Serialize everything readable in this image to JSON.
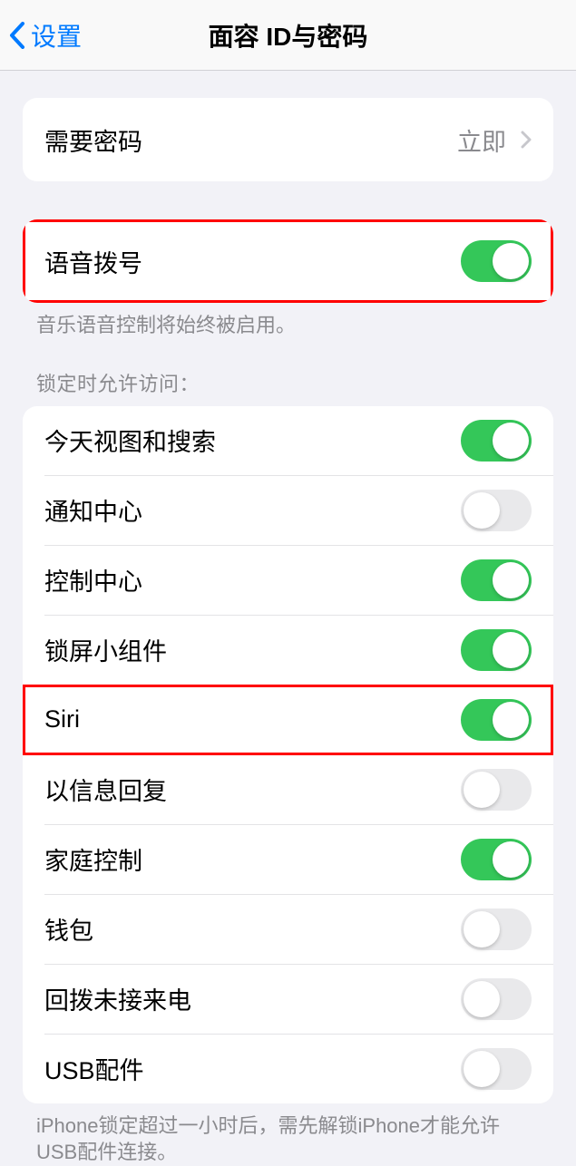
{
  "header": {
    "back_label": "设置",
    "title": "面容 ID与密码"
  },
  "require_passcode": {
    "label": "需要密码",
    "value": "立即"
  },
  "voice_dial": {
    "label": "语音拨号",
    "on": true,
    "footer": "音乐语音控制将始终被启用。"
  },
  "lock_access": {
    "header": "锁定时允许访问：",
    "items": [
      {
        "label": "今天视图和搜索",
        "on": true
      },
      {
        "label": "通知中心",
        "on": false
      },
      {
        "label": "控制中心",
        "on": true
      },
      {
        "label": "锁屏小组件",
        "on": true
      },
      {
        "label": "Siri",
        "on": true
      },
      {
        "label": "以信息回复",
        "on": false
      },
      {
        "label": "家庭控制",
        "on": true
      },
      {
        "label": "钱包",
        "on": false
      },
      {
        "label": "回拨未接来电",
        "on": false
      },
      {
        "label": "USB配件",
        "on": false
      }
    ],
    "footer": "iPhone锁定超过一小时后，需先解锁iPhone才能允许USB配件连接。"
  }
}
